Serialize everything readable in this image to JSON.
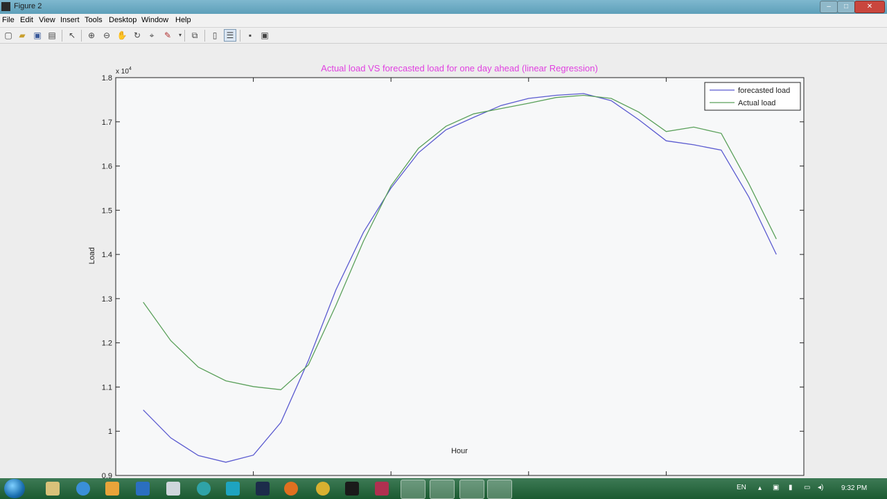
{
  "window": {
    "title": "Figure 2",
    "controls": [
      "–",
      "□",
      "✕"
    ]
  },
  "menu": [
    "File",
    "Edit",
    "View",
    "Insert",
    "Tools",
    "Desktop",
    "Window",
    "Help"
  ],
  "toolbar": {
    "icons": [
      "new-figure-icon",
      "open-file-icon",
      "save-icon",
      "print-icon",
      "select-arrow-icon",
      "zoom-in-icon",
      "zoom-out-icon",
      "pan-icon",
      "rotate-icon",
      "data-cursor-icon",
      "brush-icon",
      "link-plot-icon",
      "colorbar-icon",
      "legend-icon",
      "hide-tools-icon",
      "show-tools-icon"
    ]
  },
  "chart_data": {
    "type": "line",
    "title": "Actual load VS forecasted load for one day ahead (linear Regression)",
    "xlabel": "Hour",
    "ylabel": "Load",
    "y_exponent": "x 10",
    "y_exponent_power": "4",
    "xlim": [
      0,
      25
    ],
    "ylim": [
      0.9,
      1.8
    ],
    "xticks": [
      "0",
      "5",
      "10",
      "15",
      "20",
      "25"
    ],
    "yticks": [
      "0.9",
      "1",
      "1.1",
      "1.2",
      "1.3",
      "1.4",
      "1.5",
      "1.6",
      "1.7",
      "1.8"
    ],
    "grid": false,
    "legend_position": "top-right",
    "x": [
      1,
      2,
      3,
      4,
      5,
      6,
      7,
      8,
      9,
      10,
      11,
      12,
      13,
      14,
      15,
      16,
      17,
      18,
      19,
      20,
      21,
      22,
      23,
      24
    ],
    "series": [
      {
        "name": "forecasted load",
        "color": "#5a5ad0",
        "values": [
          1.048,
          0.985,
          0.945,
          0.93,
          0.946,
          1.02,
          1.16,
          1.32,
          1.45,
          1.55,
          1.63,
          1.682,
          1.71,
          1.737,
          1.753,
          1.76,
          1.764,
          1.748,
          1.705,
          1.657,
          1.648,
          1.636,
          1.53,
          1.4
        ]
      },
      {
        "name": "Actual load",
        "color": "#5aa05a",
        "values": [
          1.292,
          1.205,
          1.145,
          1.114,
          1.101,
          1.094,
          1.15,
          1.285,
          1.43,
          1.555,
          1.64,
          1.69,
          1.718,
          1.73,
          1.742,
          1.755,
          1.76,
          1.753,
          1.722,
          1.678,
          1.688,
          1.674,
          1.56,
          1.435
        ]
      }
    ]
  },
  "taskbar": {
    "language": "EN",
    "time": "9:32 PM",
    "apps": [
      "start-icon",
      "explorer-icon",
      "internet-explorer-icon",
      "media-player-icon",
      "outlook-icon",
      "notepad-icon",
      "arduino-icon",
      "photoshop-icon",
      "firefox-icon",
      "chrome-icon",
      "terminal-icon",
      "media-icon",
      "file-manager-icon",
      "chrome-icon",
      "utility-icon",
      "matlab-icon"
    ]
  },
  "colors": {
    "title": "#e040e0",
    "axes_bg": "#f7f8f9",
    "figure_bg": "#ededed",
    "titlebar": "#6eaac2",
    "taskbar": "#2b6b3f"
  }
}
